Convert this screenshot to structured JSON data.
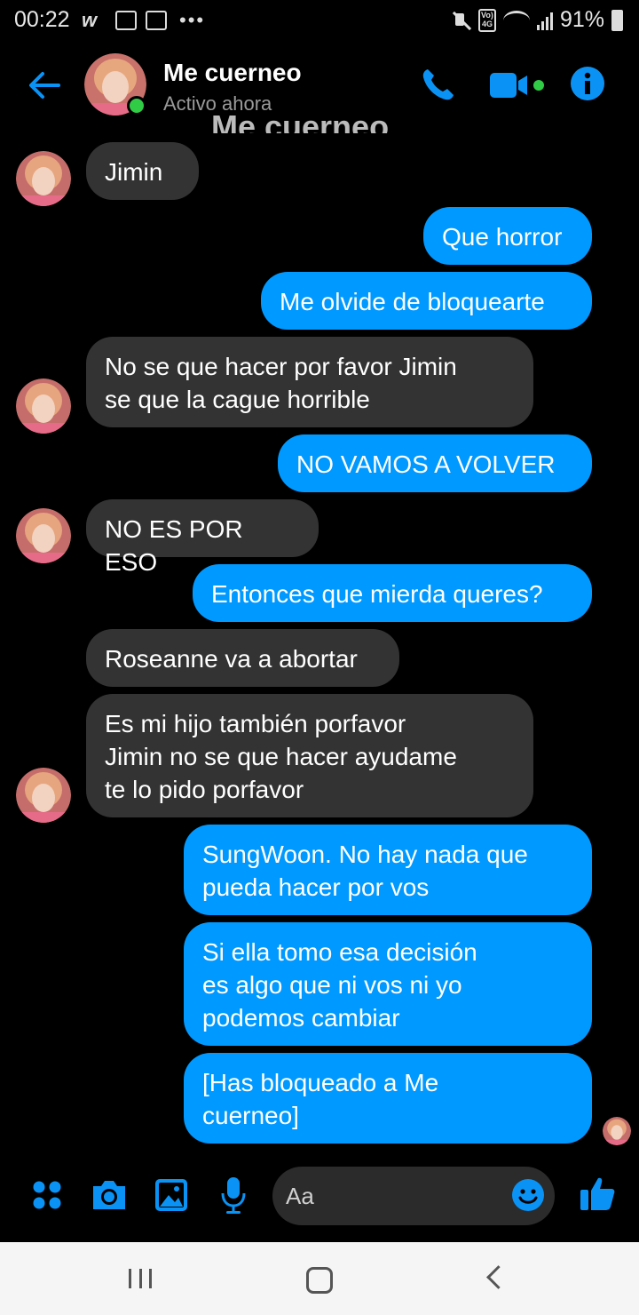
{
  "status_bar": {
    "time": "00:22",
    "battery": "91%",
    "icons": [
      "w-app-icon",
      "gallery-icon",
      "mail-icon",
      "more-dots-icon",
      "mute-icon",
      "volte-4g-icon",
      "wifi-icon",
      "signal-icon",
      "battery-icon"
    ],
    "volte_text": "Vo) 4G"
  },
  "header": {
    "title": "Me cuerneo",
    "subtitle": "Activo ahora",
    "truncated_heading": "Me cuerneo"
  },
  "messages": [
    {
      "side": "in",
      "text": "Jimin"
    },
    {
      "side": "out",
      "text": "Que horror"
    },
    {
      "side": "out",
      "text": "Me olvide de bloquearte"
    },
    {
      "side": "in",
      "text": "No se que hacer por favor Jimin\nse que la cague horrible"
    },
    {
      "side": "out",
      "text": "NO VAMOS A VOLVER"
    },
    {
      "side": "in",
      "text": "NO ES POR ESO"
    },
    {
      "side": "out",
      "text": "Entonces que mierda queres?"
    },
    {
      "side": "in",
      "text": "Roseanne va a abortar"
    },
    {
      "side": "in",
      "text": "Es mi hijo también porfavor\nJimin no se que hacer ayudame\nte lo pido porfavor"
    },
    {
      "side": "out",
      "text": "SungWoon. No hay nada que\npueda hacer por vos"
    },
    {
      "side": "out",
      "text": "Si ella tomo esa decisión\nes algo que ni vos ni yo\npodemos cambiar"
    },
    {
      "side": "out",
      "text": "[Has bloqueado a Me\ncuerneo]"
    }
  ],
  "composer": {
    "placeholder": "Aa"
  },
  "colors": {
    "accent": "#0099ff",
    "incoming_bubble": "#333333",
    "online": "#31cc46"
  }
}
